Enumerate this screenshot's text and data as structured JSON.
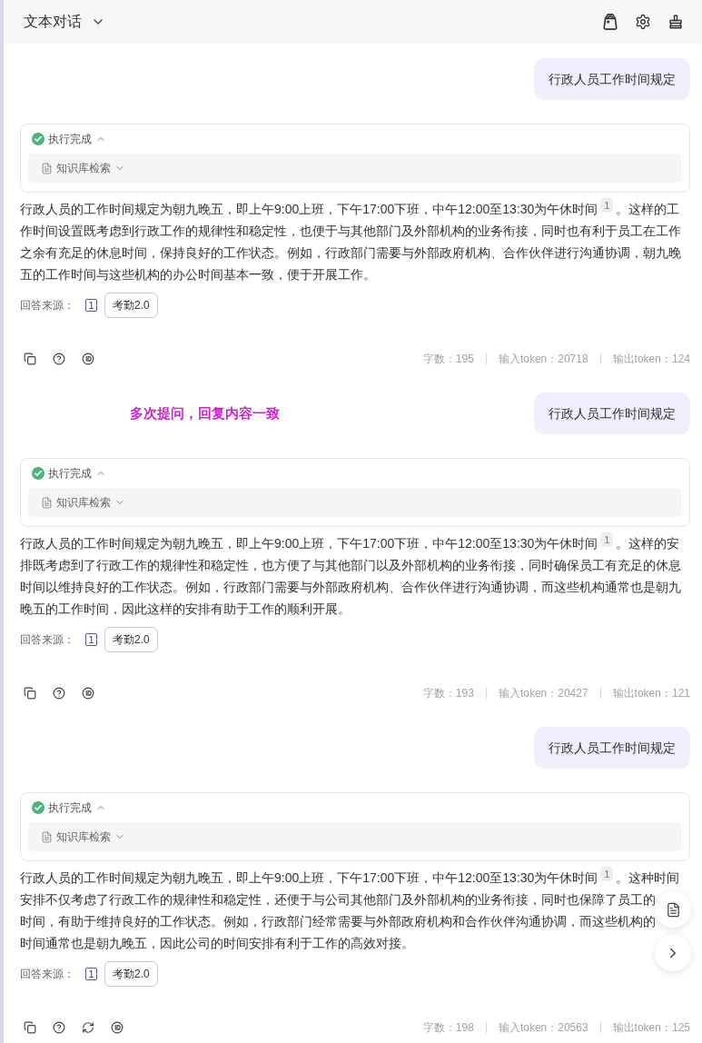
{
  "header": {
    "title": "文本对话",
    "menu_expanded": false
  },
  "conversation": [
    {
      "question": "行政人员工作时间规定",
      "answer": {
        "status": {
          "label": "执行完成",
          "expanded": true
        },
        "step": {
          "label": "知识库检索",
          "expanded": false
        },
        "first_line": {
          "before": "行政人员的工作时间规定为朝九晚五，即上午9:00上班，下午17:00下班，中午12:00至13:30为午休时间",
          "citation": "1",
          "after": "。这样的工"
        },
        "lines": [
          "作时间设置既考虑到行政工作的规律性和稳定性，也便于与其他部门及外部机构的业务衔接，同时也有利于员工在工作",
          "之余有充足的休息时间，保持良好的工作状态。例如，行政部门需要与外部政府机构、合作伙伴进行沟通协调，朝九晚",
          "五的工作时间与这些机构的办公时间基本一致，便于开展工作。"
        ],
        "sources": {
          "label": "回答来源：",
          "index": "1",
          "documents": [
            "考勤2.0"
          ]
        },
        "actions": [
          {
            "kind": "copy"
          },
          {
            "kind": "help"
          },
          {
            "kind": "id"
          }
        ],
        "stats": [
          "字数：195",
          "输入token：20718",
          "输出token：124"
        ]
      }
    },
    {
      "question": "行政人员工作时间规定",
      "note": "多次提问，回复内容一致",
      "answer": {
        "status": {
          "label": "执行完成",
          "expanded": true
        },
        "step": {
          "label": "知识库检索",
          "expanded": false
        },
        "first_line": {
          "before": "行政人员的工作时间规定为朝九晚五，即上午9:00上班，下午17:00下班，中午12:00至13:30为午休时间",
          "citation": "1",
          "after": "。这样的安"
        },
        "lines": [
          "排既考虑到了行政工作的规律性和稳定性，也方便了与其他部门以及外部机构的业务衔接，同时确保员工有充足的休息",
          "时间以维持良好的工作状态。例如，行政部门需要与外部政府机构、合作伙伴进行沟通协调，而这些机构通常也是朝九",
          "晚五的工作时间，因此这样的安排有助于工作的顺利开展。"
        ],
        "sources": {
          "label": "回答来源：",
          "index": "1",
          "documents": [
            "考勤2.0"
          ]
        },
        "actions": [
          {
            "kind": "copy"
          },
          {
            "kind": "help"
          },
          {
            "kind": "id"
          }
        ],
        "stats": [
          "字数：193",
          "输入token：20427",
          "输出token：121"
        ]
      }
    },
    {
      "question": "行政人员工作时间规定",
      "answer": {
        "status": {
          "label": "执行完成",
          "expanded": true
        },
        "step": {
          "label": "知识库检索",
          "expanded": false
        },
        "first_line": {
          "before": "行政人员的工作时间规定为朝九晚五，即上午9:00上班，下午17:00下班，中午12:00至13:30为午休时间",
          "citation": "1",
          "after": "。这种时间"
        },
        "lines": [
          "安排不仅考虑了行政工作的规律性和稳定性，还便于与公司其他部门及外部机构的业务衔接，同时也保障了员工的",
          "时间，有助于维持良好的工作状态。例如，行政部门经常需要与外部政府机构和合作伙伴沟通协调，而这些机构的",
          "时间通常也是朝九晚五，因此公司的时间安排有利于工作的高效对接。"
        ],
        "sources": {
          "label": "回答来源：",
          "index": "1",
          "documents": [
            "考勤2.0"
          ]
        },
        "actions": [
          {
            "kind": "copy"
          },
          {
            "kind": "help"
          },
          {
            "kind": "regenerate"
          },
          {
            "kind": "id"
          }
        ],
        "stats": [
          "字数：198",
          "输入token：20563",
          "输出token：125"
        ]
      }
    }
  ]
}
